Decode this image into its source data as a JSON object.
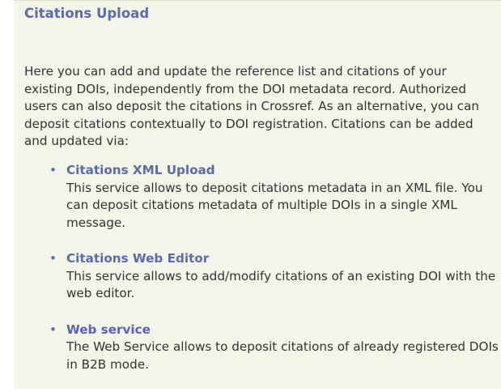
{
  "title": "Citations Upload",
  "intro": "Here you can add and update the reference list and citations of your existing DOIs, independently from the DOI metadata record. Authorized users can also deposit the citations in Crossref. As an alternative, you can deposit citations contextually to DOI registration. Citations can be added and updated via:",
  "services": [
    {
      "link": "Citations XML Upload",
      "description": "This service allows to deposit citations metadata in an XML file. You can deposit citations metadata of multiple DOIs in a single XML message."
    },
    {
      "link": "Citations Web Editor",
      "description": "This service allows to add/modify citations of an existing DOI with the web editor."
    },
    {
      "link": "Web service",
      "description": "The Web Service allows to deposit citations of already registered DOIs in B2B mode."
    }
  ],
  "colors": {
    "panel_background": "#f3f5e9",
    "title": "#5c6bab",
    "link": "#5c6bab",
    "text": "#333333"
  }
}
